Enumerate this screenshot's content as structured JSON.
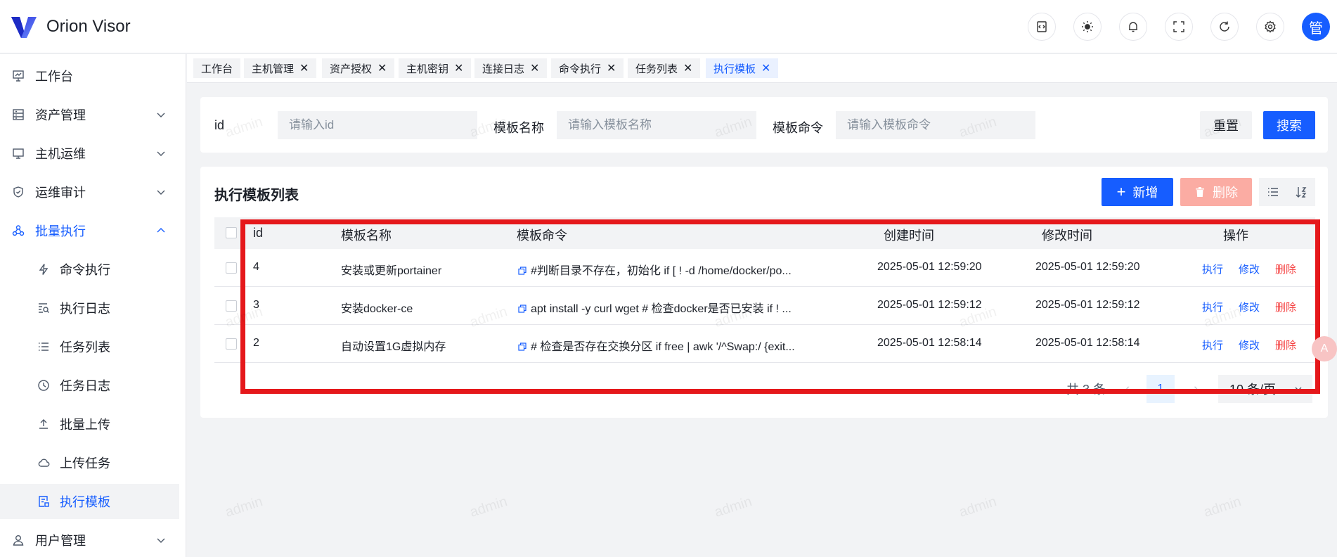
{
  "app": {
    "name": "Orion Visor",
    "avatar_text": "管"
  },
  "header": {
    "icons": [
      "code-icon",
      "sun-icon",
      "bell-icon",
      "fullscreen-icon",
      "refresh-icon",
      "gear-icon"
    ]
  },
  "sidebar": {
    "items": [
      {
        "label": "工作台",
        "icon": "dashboard-icon"
      },
      {
        "label": "资产管理",
        "icon": "asset-icon"
      },
      {
        "label": "主机运维",
        "icon": "monitor-icon"
      },
      {
        "label": "运维审计",
        "icon": "shield-icon"
      },
      {
        "label": "批量执行",
        "icon": "cluster-icon"
      },
      {
        "label": "命令执行",
        "icon": "lightning-icon"
      },
      {
        "label": "执行日志",
        "icon": "log-search-icon"
      },
      {
        "label": "任务列表",
        "icon": "list-icon"
      },
      {
        "label": "任务日志",
        "icon": "history-icon"
      },
      {
        "label": "批量上传",
        "icon": "upload-icon"
      },
      {
        "label": "上传任务",
        "icon": "cloud-icon"
      },
      {
        "label": "执行模板",
        "icon": "template-icon"
      },
      {
        "label": "用户管理",
        "icon": "user-icon"
      }
    ]
  },
  "tabs": [
    {
      "label": "工作台"
    },
    {
      "label": "主机管理"
    },
    {
      "label": "资产授权"
    },
    {
      "label": "主机密钥"
    },
    {
      "label": "连接日志"
    },
    {
      "label": "命令执行"
    },
    {
      "label": "任务列表"
    },
    {
      "label": "执行模板"
    }
  ],
  "search": {
    "id_label": "id",
    "id_placeholder": "请输入id",
    "name_label": "模板名称",
    "name_placeholder": "请输入模板名称",
    "command_label": "模板命令",
    "command_placeholder": "请输入模板命令",
    "reset_label": "重置",
    "search_label": "搜索"
  },
  "table": {
    "title": "执行模板列表",
    "add_label": "新增",
    "delete_label": "删除",
    "columns": [
      "id",
      "模板名称",
      "模板命令",
      "创建时间",
      "修改时间",
      "操作"
    ],
    "rows": [
      {
        "id": "4",
        "name": "安装或更新portainer",
        "command": "#判断目录不存在，初始化 if [ ! -d /home/docker/po...",
        "created": "2025-05-01 12:59:20",
        "modified": "2025-05-01 12:59:20"
      },
      {
        "id": "3",
        "name": "安装docker-ce",
        "command": "apt install -y curl wget # 检查docker是否已安装 if ! ...",
        "created": "2025-05-01 12:59:12",
        "modified": "2025-05-01 12:59:12"
      },
      {
        "id": "2",
        "name": "自动设置1G虚拟内存",
        "command": "# 检查是否存在交换分区 if free | awk '/^Swap:/ {exit...",
        "created": "2025-05-01 12:58:14",
        "modified": "2025-05-01 12:58:14"
      }
    ],
    "actions": {
      "exec": "执行",
      "edit": "修改",
      "delete": "删除"
    },
    "pagination": {
      "total": "共 3 条",
      "prev": "‹",
      "page": "1",
      "next": "›",
      "page_size": "10 条/页"
    }
  },
  "watermark": "admin",
  "float_badge": "A",
  "colors": {
    "primary": "#165dff",
    "danger": "#f53f3f",
    "highlight": "#e5181b"
  }
}
